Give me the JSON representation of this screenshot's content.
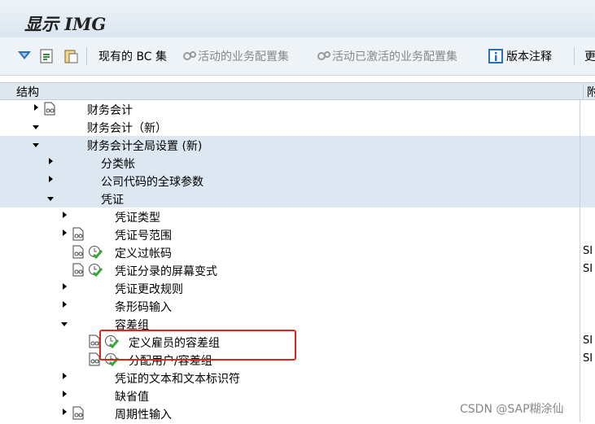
{
  "title": "显示 IMG",
  "toolbar": {
    "existing_bc": "现有的 BC 集",
    "active_bc": "活动的业务配置集",
    "activated_bc": "活动已激活的业务配置集",
    "release_notes": "版本注释",
    "more": "更"
  },
  "header": {
    "structure": "结构",
    "right": "附"
  },
  "tree": [
    {
      "label": "财务会计",
      "level": 0,
      "exp": "c",
      "doc": true,
      "clock": false,
      "right": ""
    },
    {
      "label": "财务会计（新）",
      "level": 0,
      "exp": "o",
      "doc": false,
      "clock": false,
      "right": ""
    },
    {
      "label": "财务会计全局设置 (新)",
      "level": 1,
      "exp": "o",
      "doc": false,
      "clock": false,
      "right": ""
    },
    {
      "label": "分类帐",
      "level": 2,
      "exp": "c",
      "doc": false,
      "clock": false,
      "right": ""
    },
    {
      "label": "公司代码的全球参数",
      "level": 2,
      "exp": "c",
      "doc": false,
      "clock": false,
      "right": ""
    },
    {
      "label": "凭证",
      "level": 2,
      "exp": "o",
      "doc": false,
      "clock": false,
      "right": ""
    },
    {
      "label": "凭证类型",
      "level": 3,
      "exp": "c",
      "doc": false,
      "clock": false,
      "right": ""
    },
    {
      "label": "凭证号范围",
      "level": 3,
      "exp": "c",
      "doc": true,
      "clock": false,
      "right": ""
    },
    {
      "label": "定义过帐码",
      "level": 3,
      "exp": "dot",
      "doc": true,
      "clock": true,
      "right": "SI"
    },
    {
      "label": "凭证分录的屏幕变式",
      "level": 3,
      "exp": "dot",
      "doc": true,
      "clock": true,
      "right": "SI"
    },
    {
      "label": "凭证更改规则",
      "level": 3,
      "exp": "c",
      "doc": false,
      "clock": false,
      "right": ""
    },
    {
      "label": "条形码输入",
      "level": 3,
      "exp": "c",
      "doc": false,
      "clock": false,
      "right": ""
    },
    {
      "label": "容差组",
      "level": 3,
      "exp": "o",
      "doc": false,
      "clock": false,
      "right": ""
    },
    {
      "label": "定义雇员的容差组",
      "level": 4,
      "exp": "dot",
      "doc": true,
      "clock": true,
      "right": "SI"
    },
    {
      "label": "分配用户/容差组",
      "level": 4,
      "exp": "dot",
      "doc": true,
      "clock": true,
      "right": "SI"
    },
    {
      "label": "凭证的文本和文本标识符",
      "level": 3,
      "exp": "c",
      "doc": false,
      "clock": false,
      "right": ""
    },
    {
      "label": "缺省值",
      "level": 3,
      "exp": "c",
      "doc": false,
      "clock": false,
      "right": ""
    },
    {
      "label": "周期性输入",
      "level": 3,
      "exp": "c",
      "doc": true,
      "clock": false,
      "right": ""
    }
  ],
  "watermark": "CSDN @SAP糊涂仙"
}
